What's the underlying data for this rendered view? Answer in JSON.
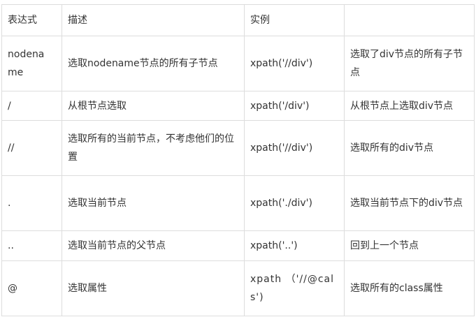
{
  "table": {
    "headers": [
      "表达式",
      "描述",
      "实例",
      ""
    ],
    "rows": [
      {
        "expression": "nodename",
        "description": "选取nodename节点的所有子节点",
        "example": "xpath('//div')",
        "result": "选取了div节点的所有子节点"
      },
      {
        "expression": "/",
        "description": "从根节点选取",
        "example": "xpath('/div')",
        "result": "从根节点上选取div节点"
      },
      {
        "expression": "//",
        "description": "选取所有的当前节点，不考虑他们的位置",
        "example": "xpath('//div')",
        "result": "选取所有的div节点"
      },
      {
        "expression": ".",
        "description": "选取当前节点",
        "example": "xpath('./div')",
        "result": "选取当前节点下的div节点"
      },
      {
        "expression": "..",
        "description": "选取当前节点的父节点",
        "example": "xpath('..')",
        "result": "回到上一个节点"
      },
      {
        "expression": "@",
        "description": "选取属性",
        "example": "xpath （'//@cals')",
        "result": "选取所有的class属性"
      }
    ]
  }
}
